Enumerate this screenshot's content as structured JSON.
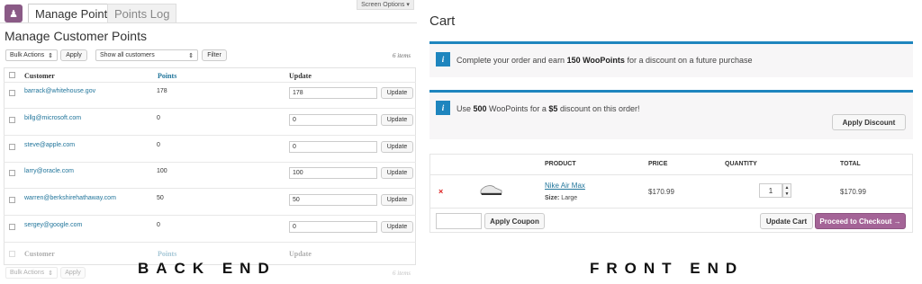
{
  "backend": {
    "tabs": [
      {
        "label": "Manage Points"
      },
      {
        "label": "Points Log"
      }
    ],
    "screen_options": "Screen Options ▾",
    "title": "Manage Customer Points",
    "bulk_actions": "Bulk Actions",
    "apply": "Apply",
    "filter_select": "Show all customers",
    "filter": "Filter",
    "item_count": "6 items",
    "columns": {
      "customer": "Customer",
      "points": "Points",
      "update": "Update"
    },
    "rows": [
      {
        "email": "barrack@whitehouse.gov",
        "points": "178",
        "value": "178"
      },
      {
        "email": "billg@microsoft.com",
        "points": "0",
        "value": "0"
      },
      {
        "email": "steve@apple.com",
        "points": "0",
        "value": "0"
      },
      {
        "email": "larry@oracle.com",
        "points": "100",
        "value": "100"
      },
      {
        "email": "warren@berkshirehathaway.com",
        "points": "50",
        "value": "50"
      },
      {
        "email": "sergey@google.com",
        "points": "0",
        "value": "0"
      }
    ],
    "update_button": "Update",
    "label": "BACK END"
  },
  "frontend": {
    "title": "Cart",
    "notice1": {
      "pre": "Complete your order and earn ",
      "bold": "150 WooPoints",
      "post": " for a discount on a future purchase"
    },
    "notice2": {
      "pre": "Use ",
      "bold1": "500",
      "mid1": " WooPoints for a ",
      "bold2": "$5",
      "post": " discount on this order!"
    },
    "apply_discount": "Apply Discount",
    "columns": {
      "product": "PRODUCT",
      "price": "PRICE",
      "quantity": "QUANTITY",
      "total": "TOTAL"
    },
    "item": {
      "remove": "×",
      "name": "Nike Air Max",
      "size_label": "Size:",
      "size": "Large",
      "price": "$170.99",
      "qty": "1",
      "total": "$170.99"
    },
    "coupon_placeholder": "",
    "apply_coupon": "Apply Coupon",
    "update_cart": "Update Cart",
    "checkout": "Proceed to Checkout →",
    "label": "FRONT END"
  },
  "colors": {
    "accent": "#1e85be",
    "purple": "#a46497",
    "link": "#21759b"
  }
}
